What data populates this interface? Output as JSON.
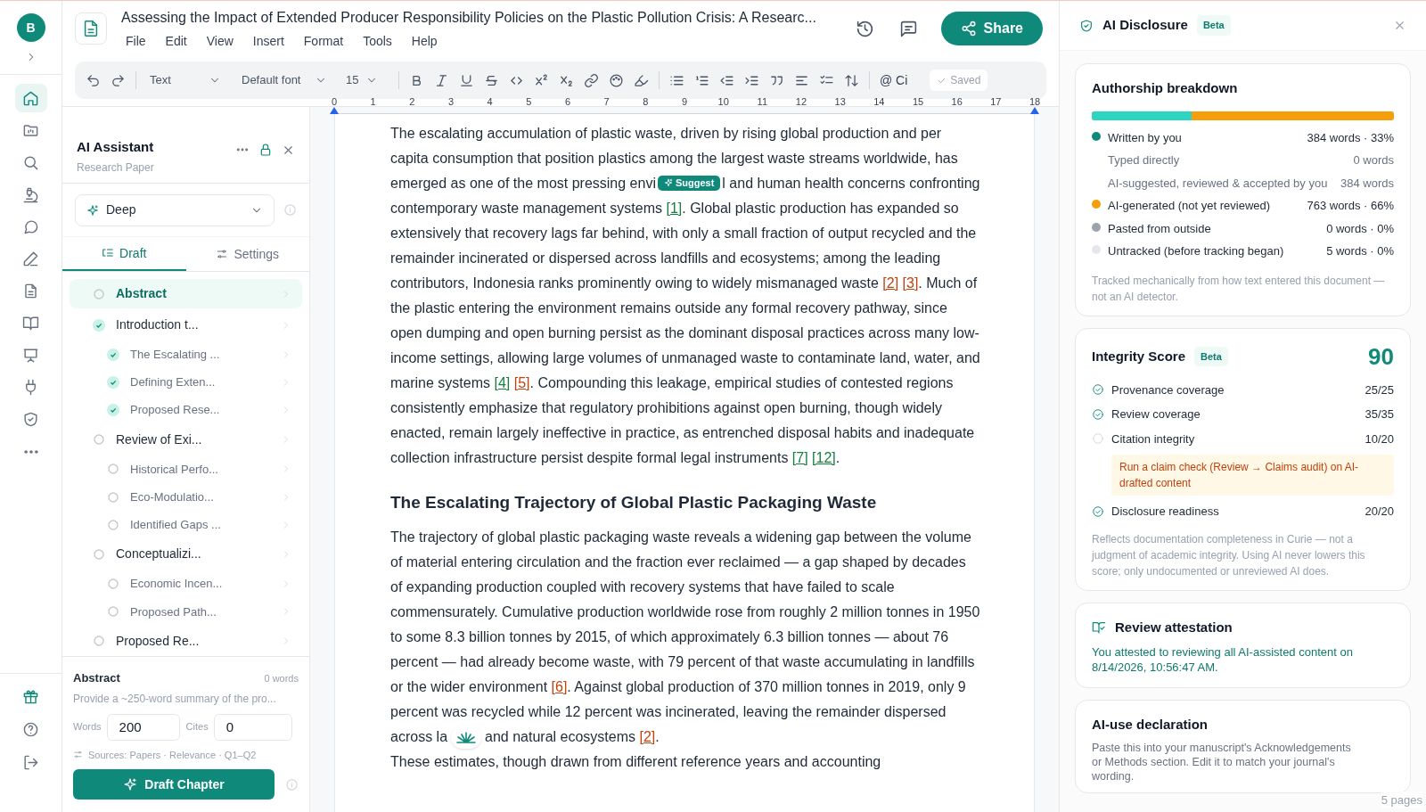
{
  "rail": {
    "avatar": "B",
    "nav": [
      {
        "selected": true
      },
      {
        "selected": false
      },
      {
        "selected": false
      },
      {
        "selected": false
      },
      {
        "selected": false
      },
      {
        "selected": false
      },
      {
        "selected": false
      },
      {
        "selected": false
      },
      {
        "selected": false
      },
      {
        "selected": false
      },
      {
        "selected": false
      }
    ]
  },
  "document": {
    "title": "Assessing the Impact of Extended Producer Responsibility Policies on the Plastic Pollution Crisis: A Researc...",
    "menu": [
      "File",
      "Edit",
      "View",
      "Insert",
      "Format",
      "Tools",
      "Help"
    ],
    "share": "Share"
  },
  "toolbar": {
    "block_style": "Text",
    "font": "Default font",
    "size": "15",
    "cite": "@ Ci",
    "saved": "Saved"
  },
  "ruler": [
    "0",
    "1",
    "2",
    "3",
    "4",
    "5",
    "6",
    "7",
    "8",
    "9",
    "10",
    "11",
    "12",
    "13",
    "14",
    "15",
    "16",
    "17",
    "18"
  ],
  "assistant": {
    "title": "AI Assistant",
    "subtitle": "Research Paper",
    "mode": "Deep",
    "tabs": [
      {
        "label": "Draft",
        "selected": true
      },
      {
        "label": "Settings",
        "selected": false
      }
    ],
    "outline": [
      {
        "label": "Abstract",
        "done": false,
        "selected": true
      },
      {
        "label": "Introduction t...",
        "done": true,
        "selected": false,
        "children": [
          {
            "label": "The Escalating ...",
            "done": true,
            "selected": false
          },
          {
            "label": "Defining Exten...",
            "done": true,
            "selected": false
          },
          {
            "label": "Proposed Rese...",
            "done": true,
            "selected": false
          }
        ]
      },
      {
        "label": "Review of Exi...",
        "done": false,
        "selected": false,
        "children": [
          {
            "label": "Historical Perfo...",
            "done": false,
            "selected": false
          },
          {
            "label": "Eco-Modulatio...",
            "done": false,
            "selected": false
          },
          {
            "label": "Identified Gaps ...",
            "done": false,
            "selected": false
          }
        ]
      },
      {
        "label": "Conceptualizi...",
        "done": false,
        "selected": false,
        "children": [
          {
            "label": "Economic Incen...",
            "done": false,
            "selected": false
          },
          {
            "label": "Proposed Path...",
            "done": false,
            "selected": false
          }
        ]
      },
      {
        "label": "Proposed Re...",
        "done": false,
        "selected": false
      }
    ],
    "section": {
      "title": "Abstract",
      "count": "0 words",
      "description": "Provide a ~250-word summary of the pro...",
      "words_label": "Words",
      "words_value": "200",
      "cites_label": "Cites",
      "cites_value": "0",
      "sources": "Sources: Papers · Relevance · Q1–Q2",
      "button": "Draft Chapter"
    }
  },
  "editor": {
    "blocks": [
      {
        "kind": "paragraph",
        "parts": [
          {
            "kind": "text",
            "text": "The escalating accumulation of plastic waste, driven by rising global production and per capita consumption that position plastics among the largest waste streams worldwide, has emerged as one of the most pressing envi"
          },
          {
            "kind": "suggest",
            "text": "Suggest"
          },
          {
            "kind": "text",
            "text": "l and human health concerns confronting contemporary waste management systems "
          },
          {
            "kind": "cite",
            "text": "[1]",
            "verified": true
          },
          {
            "kind": "text",
            "text": ". Global plastic production has expanded so extensively that recovery lags far behind, with only a small fraction of output recycled and the remainder incinerated or dispersed across landfills and ecosystems; among the leading contributors, Indonesia ranks prominently owing to widely mismanaged waste "
          },
          {
            "kind": "cite",
            "text": "[2]",
            "verified": false
          },
          {
            "kind": "cite",
            "text": "[3]",
            "verified": false
          },
          {
            "kind": "text",
            "text": ". Much of the plastic entering the environment remains outside any formal recovery pathway, since open dumping and open burning persist as the dominant disposal practices across many low-income settings, allowing large volumes of unmanaged waste to contaminate land, water, and marine systems "
          },
          {
            "kind": "cite",
            "text": "[4]",
            "verified": true
          },
          {
            "kind": "cite",
            "text": "[5]",
            "verified": false
          },
          {
            "kind": "text",
            "text": ". Compounding this leakage, empirical studies of contested regions consistently emphasize that regulatory prohibitions against open burning, though widely enacted, remain largely ineffective in practice, as entrenched disposal habits and inadequate collection infrastructure persist despite formal legal instruments "
          },
          {
            "kind": "cite",
            "text": "[7]",
            "verified": true
          },
          {
            "kind": "cite",
            "text": "[12]",
            "verified": true
          },
          {
            "kind": "text",
            "text": "."
          }
        ]
      },
      {
        "kind": "heading",
        "parts": [
          {
            "kind": "text",
            "text": "The Escalating Trajectory of Global Plastic Packaging Waste"
          }
        ]
      },
      {
        "kind": "paragraph",
        "parts": [
          {
            "kind": "text",
            "text": "The trajectory of global plastic packaging waste reveals a widening gap between the volume of material entering circulation and the fraction ever reclaimed — a gap shaped by decades of expanding production coupled with recovery systems that have failed to scale commensurately. Cumulative production worldwide rose from roughly 2 million tonnes in 1950 to some 8.3 billion tonnes by 2015, of which approximately 6.3 billion tonnes — about 76 percent — had already become waste, with 79 percent of that waste accumulating in landfills or the wider environment "
          },
          {
            "kind": "cite",
            "text": "[6]",
            "verified": false
          },
          {
            "kind": "text",
            "text": ". Against global production of 370 million tonnes in 2019, only 9 percent was recycled while 12 percent was incinerated, leaving the remainder dispersed across la"
          },
          {
            "kind": "logo"
          },
          {
            "kind": "text",
            "text": "and natural ecosystems "
          },
          {
            "kind": "cite",
            "text": "[2]",
            "verified": false
          },
          {
            "kind": "text",
            "text": "."
          }
        ]
      },
      {
        "kind": "paragraph",
        "parts": [
          {
            "kind": "text",
            "text": "These estimates, though drawn from different reference years and accounting"
          }
        ]
      }
    ]
  },
  "disclosure": {
    "title": "AI Disclosure",
    "badge": "Beta",
    "authorship": {
      "title": "Authorship breakdown",
      "bar": {
        "level": 0.33
      },
      "rows": [
        {
          "kind": "main",
          "label": "Written by you",
          "value": "384 words · 33%",
          "color": "#0f8a7a"
        },
        {
          "kind": "sub",
          "label": "Typed directly",
          "value": "0 words"
        },
        {
          "kind": "sub",
          "label": "AI-suggested, reviewed & accepted by you",
          "value": "384 words"
        },
        {
          "kind": "main",
          "label": "AI-generated (not yet reviewed)",
          "value": "763 words · 66%",
          "color": "#f59e0b"
        },
        {
          "kind": "main",
          "label": "Pasted from outside",
          "value": "0 words · 0%",
          "color": "#9ca3af"
        },
        {
          "kind": "main",
          "label": "Untracked (before tracking began)",
          "value": "5 words · 0%",
          "color": "#e5e7eb"
        }
      ],
      "note": "Tracked mechanically from how text entered this document — not an AI detector."
    },
    "integrity": {
      "title": "Integrity Score",
      "badge": "Beta",
      "score": "90",
      "items": [
        {
          "label": "Provenance coverage",
          "value": "25/25",
          "done": true
        },
        {
          "label": "Review coverage",
          "value": "35/35",
          "done": true
        },
        {
          "label": "Citation integrity",
          "value": "10/20",
          "done": false,
          "warning": "Run a claim check (Review → Claims audit) on AI-drafted content"
        },
        {
          "label": "Disclosure readiness",
          "value": "20/20",
          "done": true
        }
      ],
      "note": "Reflects documentation completeness in Curie — not a judgment of academic integrity. Using AI never lowers this score; only undocumented or unreviewed AI does."
    },
    "attestation": {
      "title": "Review attestation",
      "text": "You attested to reviewing all AI-assisted content on 8/14/2026, 10:56:47 AM."
    },
    "declaration": {
      "title": "AI-use declaration",
      "text": "Paste this into your manuscript's Acknowledgements or Methods section. Edit it to match your journal's wording."
    },
    "page_count": "5 pages"
  }
}
